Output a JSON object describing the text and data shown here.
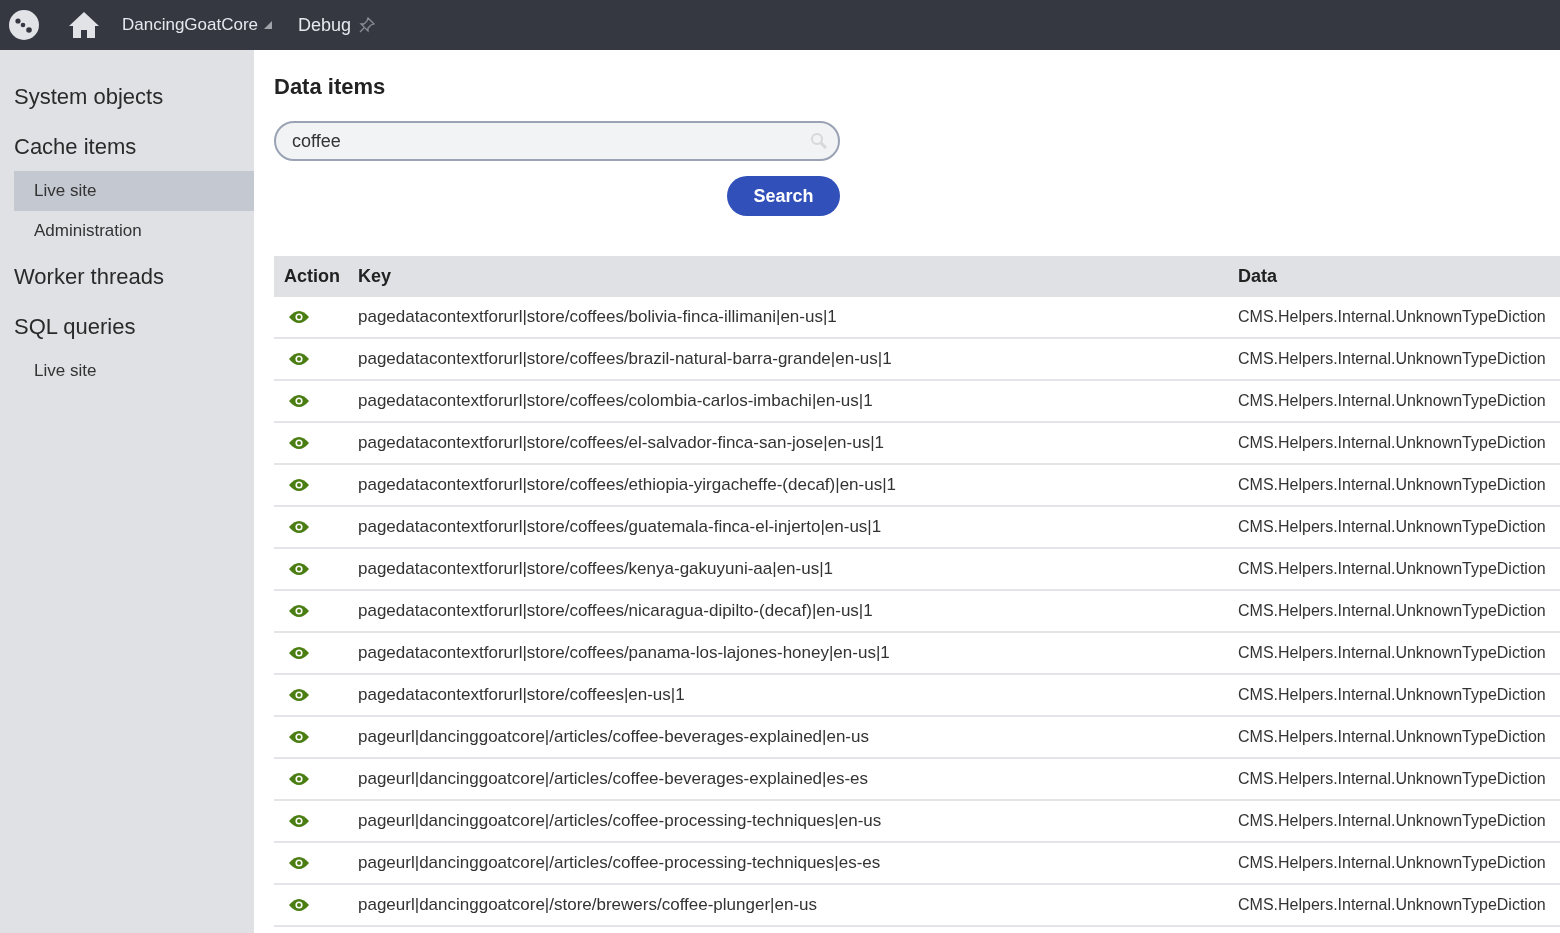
{
  "topbar": {
    "site": "DancingGoatCore",
    "section": "Debug"
  },
  "sidebar": {
    "items": [
      {
        "label": "System objects",
        "selected": false
      },
      {
        "label": "Cache items",
        "selected": false,
        "children": [
          {
            "label": "Live site",
            "selected": true
          },
          {
            "label": "Administration",
            "selected": false
          }
        ]
      },
      {
        "label": "Worker threads",
        "selected": false
      },
      {
        "label": "SQL queries",
        "selected": false,
        "children": [
          {
            "label": "Live site",
            "selected": false
          }
        ]
      }
    ]
  },
  "page": {
    "title": "Data items",
    "search": {
      "value": "coffee"
    },
    "search_button": "Search"
  },
  "table": {
    "columns": [
      "Action",
      "Key",
      "Data"
    ],
    "rows": [
      {
        "key": "pagedatacontextforurl|store/coffees/bolivia-finca-illimani|en-us|1",
        "data": "CMS.Helpers.Internal.UnknownTypeDiction"
      },
      {
        "key": "pagedatacontextforurl|store/coffees/brazil-natural-barra-grande|en-us|1",
        "data": "CMS.Helpers.Internal.UnknownTypeDiction"
      },
      {
        "key": "pagedatacontextforurl|store/coffees/colombia-carlos-imbachi|en-us|1",
        "data": "CMS.Helpers.Internal.UnknownTypeDiction"
      },
      {
        "key": "pagedatacontextforurl|store/coffees/el-salvador-finca-san-jose|en-us|1",
        "data": "CMS.Helpers.Internal.UnknownTypeDiction"
      },
      {
        "key": "pagedatacontextforurl|store/coffees/ethiopia-yirgacheffe-(decaf)|en-us|1",
        "data": "CMS.Helpers.Internal.UnknownTypeDiction"
      },
      {
        "key": "pagedatacontextforurl|store/coffees/guatemala-finca-el-injerto|en-us|1",
        "data": "CMS.Helpers.Internal.UnknownTypeDiction"
      },
      {
        "key": "pagedatacontextforurl|store/coffees/kenya-gakuyuni-aa|en-us|1",
        "data": "CMS.Helpers.Internal.UnknownTypeDiction"
      },
      {
        "key": "pagedatacontextforurl|store/coffees/nicaragua-dipilto-(decaf)|en-us|1",
        "data": "CMS.Helpers.Internal.UnknownTypeDiction"
      },
      {
        "key": "pagedatacontextforurl|store/coffees/panama-los-lajones-honey|en-us|1",
        "data": "CMS.Helpers.Internal.UnknownTypeDiction"
      },
      {
        "key": "pagedatacontextforurl|store/coffees|en-us|1",
        "data": "CMS.Helpers.Internal.UnknownTypeDiction"
      },
      {
        "key": "pageurl|dancinggoatcore|/articles/coffee-beverages-explained|en-us",
        "data": "CMS.Helpers.Internal.UnknownTypeDiction"
      },
      {
        "key": "pageurl|dancinggoatcore|/articles/coffee-beverages-explained|es-es",
        "data": "CMS.Helpers.Internal.UnknownTypeDiction"
      },
      {
        "key": "pageurl|dancinggoatcore|/articles/coffee-processing-techniques|en-us",
        "data": "CMS.Helpers.Internal.UnknownTypeDiction"
      },
      {
        "key": "pageurl|dancinggoatcore|/articles/coffee-processing-techniques|es-es",
        "data": "CMS.Helpers.Internal.UnknownTypeDiction"
      },
      {
        "key": "pageurl|dancinggoatcore|/store/brewers/coffee-plunger|en-us",
        "data": "CMS.Helpers.Internal.UnknownTypeDiction"
      }
    ]
  }
}
